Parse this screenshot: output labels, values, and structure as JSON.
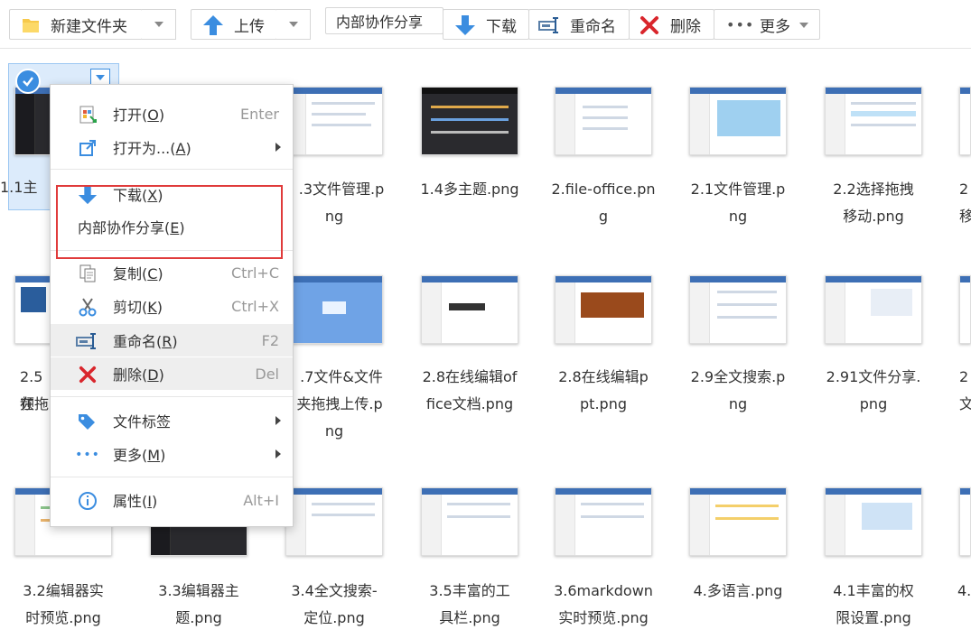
{
  "toolbar": {
    "new_folder": "新建文件夹",
    "upload": "上传",
    "share": "内部协作分享",
    "download": "下载",
    "rename": "重命名",
    "delete": "删除",
    "more": "更多"
  },
  "colors": {
    "accent": "#3b8de0",
    "red": "#e03b3b",
    "selection": "#dcebfb"
  },
  "files": [
    [
      "1.1主",
      "",
      "2.3文件管理.png",
      "1.4多主题.png",
      "2.file-office.png",
      "2.1文件管理.png",
      "2.2选择拖拽移动.png",
      "2"
    ],
    [
      "2.5在频拖",
      "",
      "2.7文件&文件夹拖拽上传.png",
      "2.8在线编辑office文档.png",
      "2.8在线编辑ppt.png",
      "2.9全文搜索.png",
      "2.91文件分享.png",
      "2文"
    ],
    [
      "3.2编辑器实时预览.png",
      "3.3编辑器主题.png",
      "3.4全文搜索-定位.png",
      "3.5丰富的工具栏.png",
      "3.6markdown实时预览.png",
      "4.多语言.png",
      "4.1丰富的权限设置.png",
      "4."
    ]
  ],
  "names": {
    "r1c1": "1.1主",
    "r1c3a": ".3文件管理.p",
    "r1c3b": "ng",
    "r1c4": "1.4多主题.png",
    "r1c5a": "2.file-office.pn",
    "r1c5b": "g",
    "r1c6a": "2.1文件管理.p",
    "r1c6b": "ng",
    "r1c7a": "2.2选择拖拽",
    "r1c7b": "移动.png",
    "r1c8a": "2",
    "r1c8b": "移",
    "r2c1a": "2.5在",
    "r2c1b": "频拖",
    "r2c3a": ".7文件&文件",
    "r2c3b": "夹拖拽上传.p",
    "r2c3c": "ng",
    "r2c4a": "2.8在线编辑of",
    "r2c4b": "fice文档.png",
    "r2c5a": "2.8在线编辑p",
    "r2c5b": "pt.png",
    "r2c6a": "2.9全文搜索.p",
    "r2c6b": "ng",
    "r2c7a": "2.91文件分享.",
    "r2c7b": "png",
    "r2c8a": "2",
    "r2c8b": "文",
    "r3c1a": "3.2编辑器实",
    "r3c1b": "时预览.png",
    "r3c2a": "3.3编辑器主",
    "r3c2b": "题.png",
    "r3c3a": "3.4全文搜索-",
    "r3c3b": "定位.png",
    "r3c4a": "3.5丰富的工",
    "r3c4b": "具栏.png",
    "r3c5a": "3.6markdown",
    "r3c5b": "实时预览.png",
    "r3c6": "4.多语言.png",
    "r3c7a": "4.1丰富的权",
    "r3c7b": "限设置.png",
    "r3c8": "4."
  },
  "menu": {
    "open": "打开(",
    "open_k": "O",
    "open_end": ")",
    "open_sc": "Enter",
    "open_as": "打开为...(",
    "open_as_k": "A",
    "open_as_end": ")",
    "download": "下载(",
    "download_k": "X",
    "download_end": ")",
    "share": "内部协作分享(",
    "share_k": "E",
    "share_end": ")",
    "copy": "复制(",
    "copy_k": "C",
    "copy_end": ")",
    "copy_sc": "Ctrl+C",
    "cut": "剪切(",
    "cut_k": "K",
    "cut_end": ")",
    "cut_sc": "Ctrl+X",
    "rename": "重命名(",
    "rename_k": "R",
    "rename_end": ")",
    "rename_sc": "F2",
    "delete": "删除(",
    "delete_k": "D",
    "delete_end": ")",
    "delete_sc": "Del",
    "tags": "文件标签",
    "more": "更多(",
    "more_k": "M",
    "more_end": ")",
    "props": "属性(",
    "props_k": "I",
    "props_end": ")",
    "props_sc": "Alt+I"
  }
}
